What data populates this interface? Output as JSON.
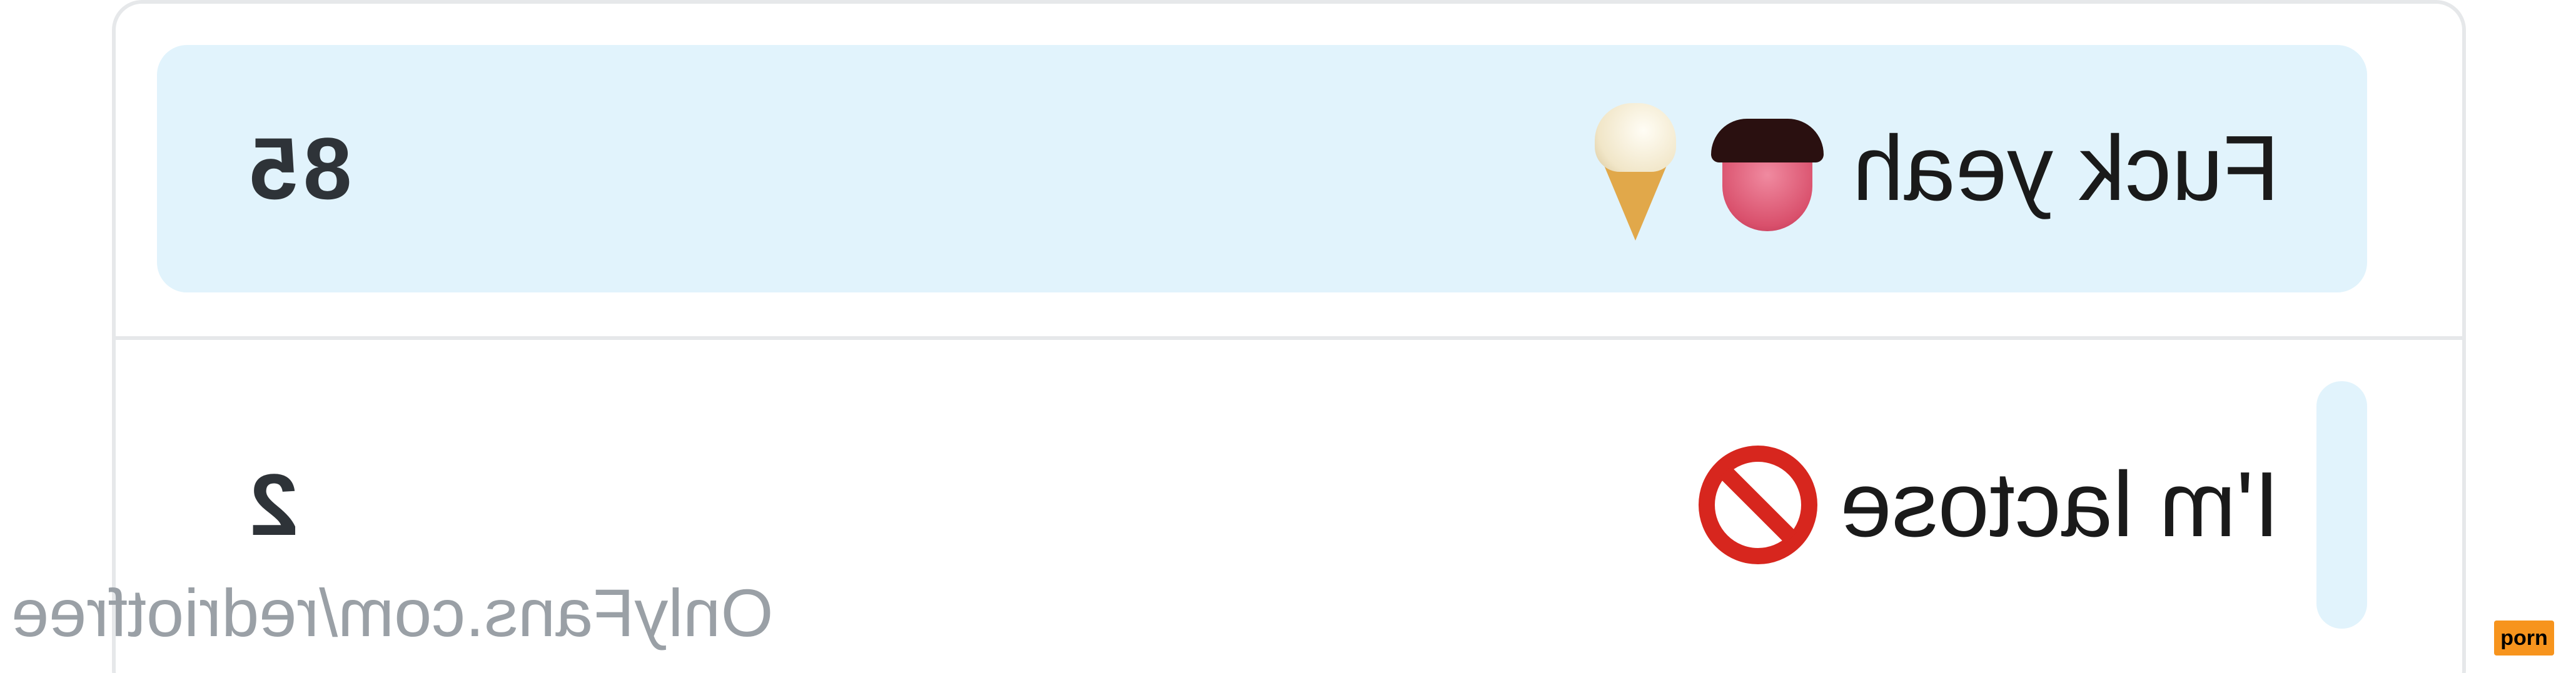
{
  "poll": {
    "options": [
      {
        "label": "Fuck yeah",
        "emojis": [
          "tongue-icon",
          "ice-cream-icon"
        ],
        "count": "85",
        "highlighted": true
      },
      {
        "label": "I'm lactose",
        "emojis": [
          "no-entry-icon"
        ],
        "count": "2",
        "highlighted": false,
        "fill_fraction": 0.023
      }
    ],
    "fill_color": "#e1f3fc"
  },
  "watermark": {
    "text": "OnlyFans.com/redriotfree"
  },
  "badge": {
    "text": "porn",
    "color": "#f7941d"
  }
}
